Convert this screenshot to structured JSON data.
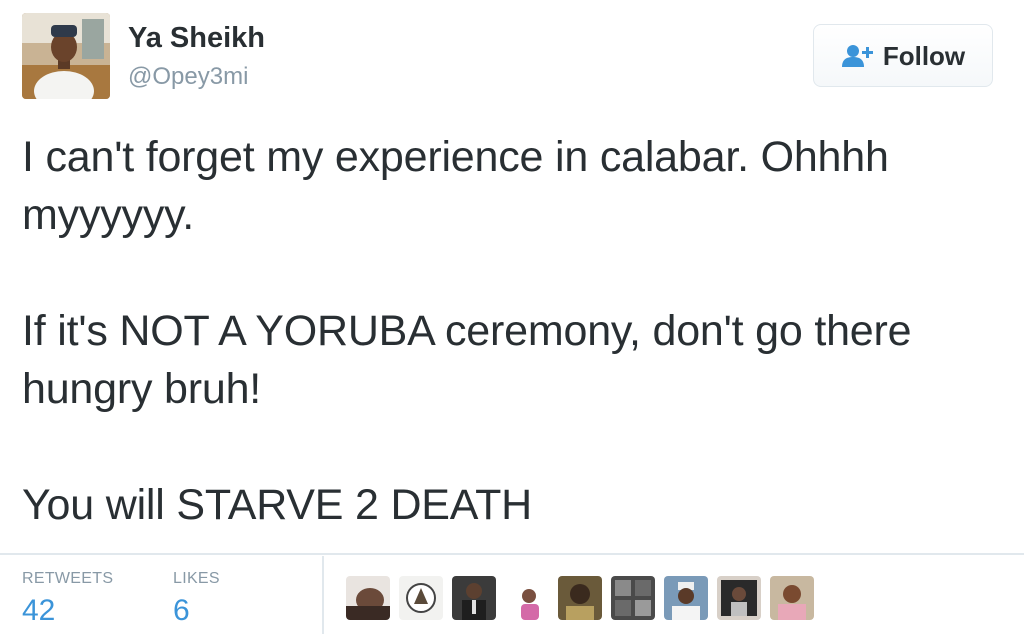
{
  "tweet": {
    "author": {
      "name": "Ya Sheikh",
      "handle": "@Opey3mi",
      "avatar_icon": "user-avatar-icon"
    },
    "follow_button": {
      "label": "Follow",
      "icon": "add-user-icon",
      "accent_color": "#3b94d9"
    },
    "paragraphs": [
      "I can't forget my experience in calabar. Ohhhh myyyyyy.",
      "If it's NOT A YORUBA ceremony, don't go there hungry bruh!",
      "You will STARVE 2 DEATH"
    ],
    "stats": {
      "retweets_label": "RETWEETS",
      "retweets_value": "42",
      "likes_label": "LIKES",
      "likes_value": "6"
    },
    "liker_avatars": [
      "user-avatar-icon",
      "user-avatar-icon",
      "user-avatar-icon",
      "user-avatar-icon",
      "user-avatar-icon",
      "user-avatar-icon",
      "user-avatar-icon",
      "user-avatar-icon",
      "user-avatar-icon"
    ]
  }
}
